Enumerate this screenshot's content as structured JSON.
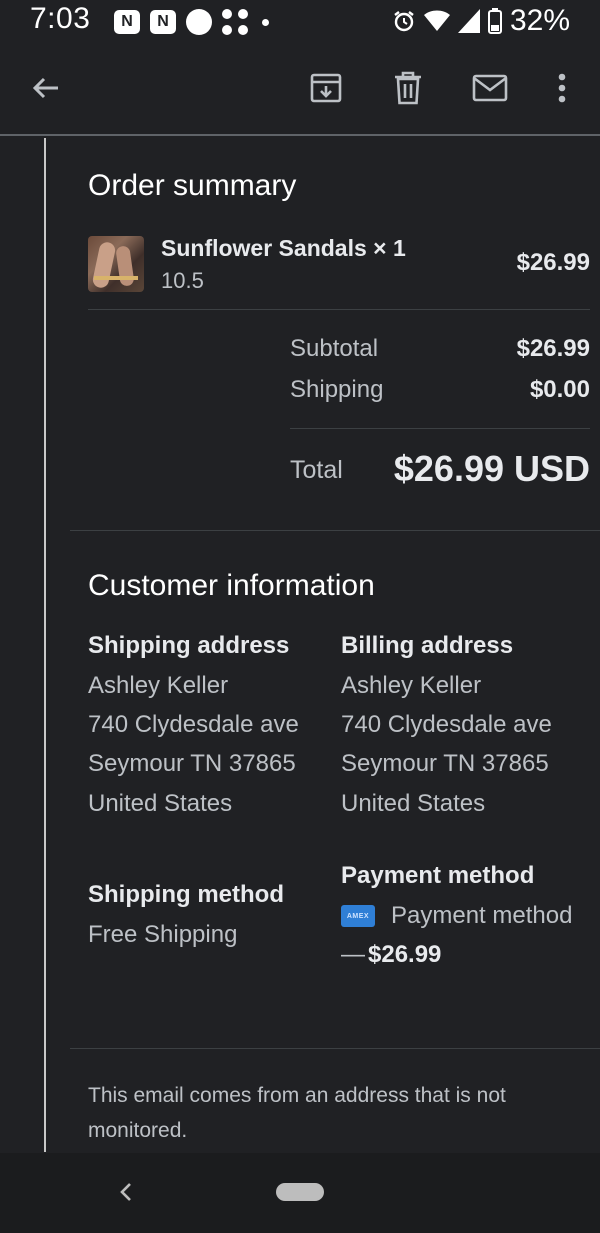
{
  "status_bar": {
    "time": "7:03",
    "notification_letter": "N",
    "battery": "32%"
  },
  "toolbar": {
    "icons": [
      "back-arrow-icon",
      "archive-icon",
      "delete-icon",
      "mail-icon",
      "more-vert-icon"
    ]
  },
  "order_summary": {
    "title": "Order summary",
    "item": {
      "name": "Sunflower Sandals × 1",
      "variant": "10.5",
      "price": "$26.99"
    },
    "subtotal_label": "Subtotal",
    "subtotal_value": "$26.99",
    "shipping_label": "Shipping",
    "shipping_value": "$0.00",
    "total_label": "Total",
    "total_value": "$26.99 USD"
  },
  "customer_information": {
    "title": "Customer information",
    "shipping_address": {
      "label": "Shipping address",
      "name": "Ashley Keller",
      "street": "740 Clydesdale ave",
      "city": "Seymour TN 37865",
      "country": "United States"
    },
    "billing_address": {
      "label": "Billing address",
      "name": "Ashley Keller",
      "street": "740 Clydesdale ave",
      "city": "Seymour TN 37865",
      "country": "United States"
    },
    "shipping_method": {
      "label": "Shipping method",
      "value": "Free Shipping"
    },
    "payment_method": {
      "label": "Payment method",
      "card_brand": "AMEX",
      "text": "Payment method",
      "dash": "—",
      "amount": "$26.99"
    }
  },
  "footer": {
    "line1": "This email comes from an address that is not",
    "line2": "monitored."
  },
  "colors": {
    "background": "#202124",
    "text_primary": "#e8eaed",
    "text_secondary": "#bdc1c6",
    "amex_blue": "#2f7fd6"
  }
}
